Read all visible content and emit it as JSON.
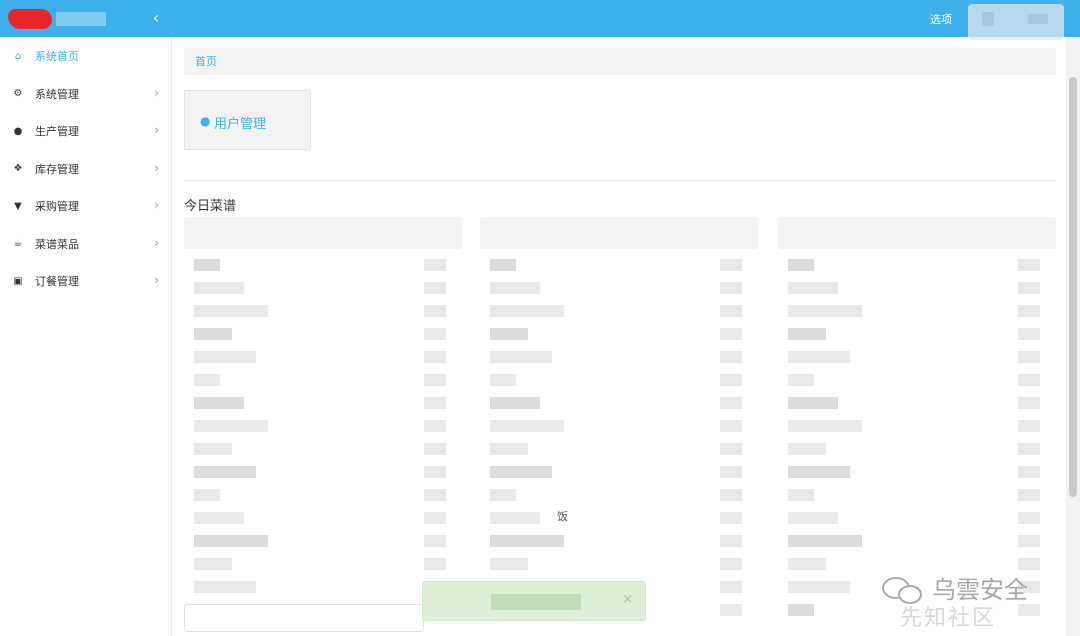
{
  "header": {
    "collapse_icon": "chevron-left-icon",
    "options_label": "选项",
    "color": "#3bb0ea"
  },
  "sidebar": {
    "items": [
      {
        "label": "系统首页",
        "icon": "home-icon",
        "glyph": "⌂",
        "active": true
      },
      {
        "label": "系统管理",
        "icon": "gears-icon",
        "glyph": "⚙",
        "active": false
      },
      {
        "label": "生产管理",
        "icon": "production-icon",
        "glyph": "●",
        "active": false
      },
      {
        "label": "库存管理",
        "icon": "cubes-icon",
        "glyph": "❖",
        "active": false
      },
      {
        "label": "采购管理",
        "icon": "cart-icon",
        "glyph": "▼",
        "active": false
      },
      {
        "label": "菜谱菜品",
        "icon": "coffee-icon",
        "glyph": "☕",
        "active": false
      },
      {
        "label": "订餐管理",
        "icon": "copy-icon",
        "glyph": "▣",
        "active": false
      }
    ],
    "arrow_glyph": "›"
  },
  "main": {
    "breadcrumb": "首页",
    "tile": {
      "label": "用户管理",
      "icon": "user-icon",
      "glyph": "👤"
    },
    "section_title": "今日菜谱",
    "stray_text": "饭"
  },
  "toast": {
    "close_glyph": "×"
  },
  "watermark": {
    "text": "乌雲安全",
    "subtext": "先知社区"
  }
}
